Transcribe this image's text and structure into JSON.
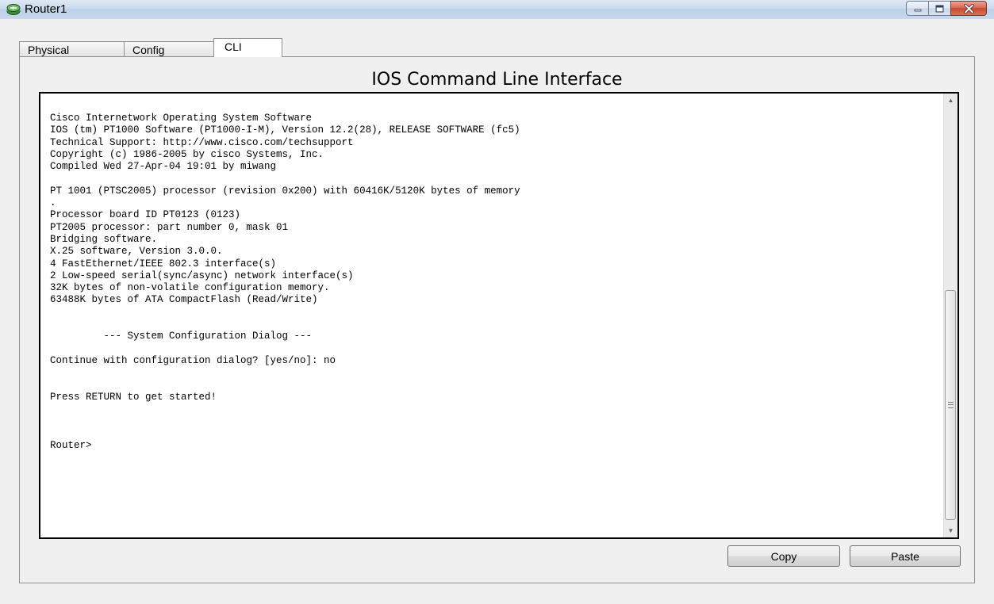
{
  "window": {
    "title": "Router1"
  },
  "tabs": [
    {
      "label": "Physical"
    },
    {
      "label": "Config"
    },
    {
      "label": "CLI"
    }
  ],
  "panel": {
    "title": "IOS Command Line Interface"
  },
  "console": {
    "output": "Cisco Internetwork Operating System Software\nIOS (tm) PT1000 Software (PT1000-I-M), Version 12.2(28), RELEASE SOFTWARE (fc5)\nTechnical Support: http://www.cisco.com/techsupport\nCopyright (c) 1986-2005 by cisco Systems, Inc.\nCompiled Wed 27-Apr-04 19:01 by miwang\n\nPT 1001 (PTSC2005) processor (revision 0x200) with 60416K/5120K bytes of memory\n.\nProcessor board ID PT0123 (0123)\nPT2005 processor: part number 0, mask 01\nBridging software.\nX.25 software, Version 3.0.0.\n4 FastEthernet/IEEE 802.3 interface(s)\n2 Low-speed serial(sync/async) network interface(s)\n32K bytes of non-volatile configuration memory.\n63488K bytes of ATA CompactFlash (Read/Write)\n\n\n         --- System Configuration Dialog ---\n\nContinue with configuration dialog? [yes/no]: no\n\n\nPress RETURN to get started!\n\n\n\nRouter>"
  },
  "buttons": {
    "copy": "Copy",
    "paste": "Paste"
  },
  "icons": {
    "app": "router-icon",
    "minimize": "minimize-icon",
    "maximize": "maximize-icon",
    "close": "close-icon"
  },
  "colors": {
    "close_button": "#c84a32",
    "console_background": "#ffffff",
    "window_background": "#f0f0f0"
  }
}
